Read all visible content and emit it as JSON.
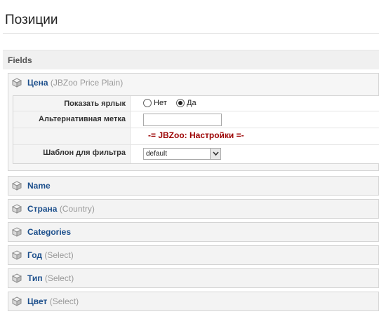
{
  "page": {
    "title": "Позиции"
  },
  "fields_section": {
    "label": "Fields"
  },
  "expanded_field": {
    "name": "Цена",
    "type": "(JBZoo Price Plain)",
    "params": {
      "show_label": {
        "label": "Показать ярлык",
        "options": [
          "Нет",
          "Да"
        ],
        "selected": "Да"
      },
      "alt_label": {
        "label": "Альтернативная метка",
        "value": ""
      },
      "settings_link": "-= JBZoo: Настройки =-",
      "filter_template": {
        "label": "Шаблон для фильтра",
        "value": "default"
      }
    }
  },
  "fields": [
    {
      "name": "Name",
      "type": ""
    },
    {
      "name": "Страна",
      "type": "(Country)"
    },
    {
      "name": "Categories",
      "type": ""
    },
    {
      "name": "Год",
      "type": "(Select)"
    },
    {
      "name": "Тип",
      "type": "(Select)"
    },
    {
      "name": "Цвет",
      "type": "(Select)"
    }
  ],
  "colors": {
    "field_name": "#1c4f8c",
    "settings_link": "#9b0000"
  },
  "icons": {
    "field": "cube-icon",
    "select": "chevron-down-icon"
  }
}
